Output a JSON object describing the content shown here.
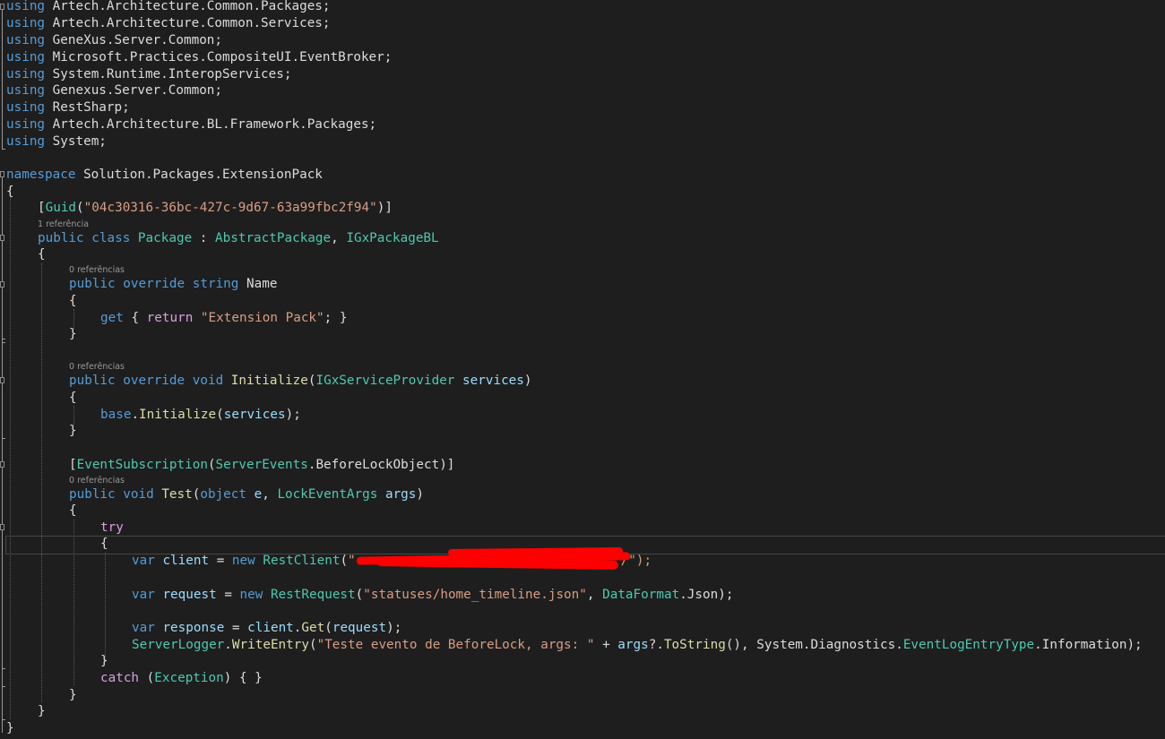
{
  "editor": {
    "code_lens": {
      "one_reference": "1 referência",
      "zero_references": "0 referências"
    },
    "usings": [
      "Artech.Architecture.Common.Packages;",
      "Artech.Architecture.Common.Services;",
      "GeneXus.Server.Common;",
      "Microsoft.Practices.CompositeUI.EventBroker;",
      "System.Runtime.InteropServices;",
      "Genexus.Server.Common;",
      "RestSharp;",
      "Artech.Architecture.BL.Framework.Packages;",
      "System;"
    ],
    "tokens": {
      "using": "using",
      "namespace": "namespace",
      "namespace_name": "Solution.Packages.ExtensionPack",
      "open_brace": "{",
      "close_brace": "}",
      "guid_attr": "Guid",
      "guid_value": "\"04c30316-36bc-427c-9d67-63a99fbc2f94\"",
      "public": "public",
      "class": "class",
      "class_name": "Package",
      "base_class": "AbstractPackage",
      "interface_name": "IGxPackageBL",
      "override": "override",
      "string": "string",
      "name_prop": "Name",
      "get": "get",
      "return": "return",
      "ext_pack_str": "\"Extension Pack\"",
      "void": "void",
      "initialize": "Initialize",
      "provider_type": "IGxServiceProvider",
      "services": "services",
      "base": "base",
      "event_attr": "EventSubscription",
      "server_events": "ServerEvents",
      "before_lock": "BeforeLockObject",
      "test_method": "Test",
      "object": "object",
      "param_e": "e",
      "lock_args_type": "LockEventArgs",
      "args": "args",
      "try": "try",
      "var": "var",
      "client": "client",
      "new": "new",
      "rest_client": "RestClient",
      "url_start": "\"",
      "url_end": "/\");",
      "request": "request",
      "rest_request": "RestRequest",
      "timeline_str": "\"statuses/home_timeline.json\"",
      "data_format": "DataFormat",
      "json_member": "Json",
      "response": "response",
      "get_method": "Get",
      "server_logger": "ServerLogger",
      "write_entry": "WriteEntry",
      "log_str": "\"Teste evento de BeforeLock, args: \"",
      "to_string": "ToString",
      "sys_diag": "System.Diagnostics.",
      "event_log_type": "EventLogEntryType",
      "information": "Information",
      "catch": "catch",
      "exception": "Exception"
    }
  }
}
